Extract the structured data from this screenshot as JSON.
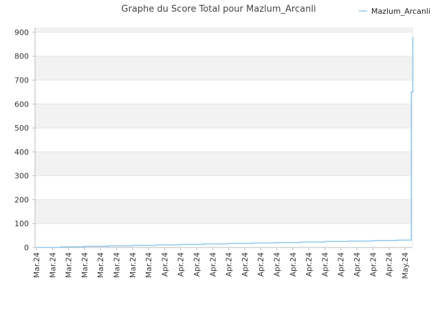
{
  "chart_data": {
    "type": "line",
    "title": "Graphe du Score Total pour Mazlum_Arcanli",
    "xlabel": "",
    "ylabel": "",
    "ylim": [
      0,
      920
    ],
    "yticks": [
      0,
      100,
      200,
      300,
      400,
      500,
      600,
      700,
      800,
      900
    ],
    "xtick_labels": [
      "Mar.24",
      "Mar.24",
      "Mar.24",
      "Mar.24",
      "Mar.24",
      "Mar.24",
      "Mar.24",
      "Mar.24",
      "Apr.24",
      "Apr.24",
      "Apr.24",
      "Apr.24",
      "Apr.24",
      "Apr.24",
      "Apr.24",
      "Apr.24",
      "Apr.24",
      "Apr.24",
      "Apr.24",
      "Apr.24",
      "Apr.24",
      "Apr.24",
      "Apr.24",
      "May.24"
    ],
    "grid": true,
    "legend_position": "top-right",
    "colors": {
      "line": "#90c8f0",
      "band": "#f2f2f2",
      "grid": "#e4e4e4",
      "axis": "#bbbbbb"
    },
    "series": [
      {
        "name": "Mazlum_Arcanli",
        "x": [
          0,
          1.5,
          1.5,
          3.0,
          3.0,
          4.5,
          4.5,
          6.0,
          6.0,
          7.5,
          7.5,
          9.0,
          9.0,
          10.5,
          10.5,
          12.0,
          12.0,
          13.5,
          13.5,
          15.0,
          15.0,
          16.5,
          16.5,
          18.0,
          18.0,
          19.5,
          19.5,
          21.0,
          21.0,
          22.5,
          22.5,
          23.4,
          23.4,
          23.5,
          23.5
        ],
        "y": [
          0,
          0,
          3,
          3,
          5,
          5,
          7,
          7,
          9,
          9,
          11,
          11,
          13,
          13,
          15,
          15,
          17,
          17,
          19,
          19,
          21,
          21,
          23,
          23,
          25,
          25,
          27,
          27,
          29,
          29,
          31,
          31,
          650,
          650,
          880
        ]
      }
    ]
  }
}
